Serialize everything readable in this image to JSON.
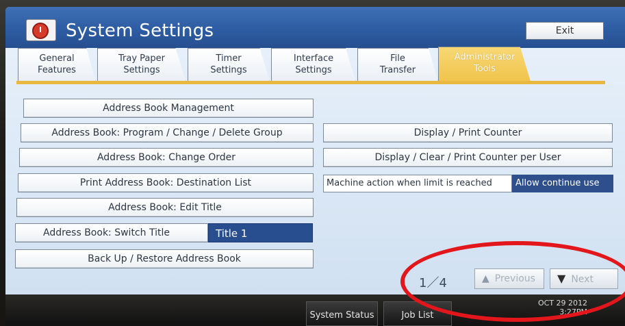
{
  "window": {
    "title": "System Settings",
    "exit_label": "Exit"
  },
  "tabs": [
    {
      "label_line1": "General",
      "label_line2": "Features"
    },
    {
      "label_line1": "Tray Paper",
      "label_line2": "Settings"
    },
    {
      "label_line1": "Timer",
      "label_line2": "Settings"
    },
    {
      "label_line1": "Interface",
      "label_line2": "Settings"
    },
    {
      "label_line1": "File",
      "label_line2": "Transfer"
    },
    {
      "label_line1": "Administrator",
      "label_line2": "Tools",
      "active": true
    }
  ],
  "left_buttons": [
    "Address Book Management",
    "Address Book: Program / Change / Delete Group",
    "Address Book: Change Order",
    "Print Address Book: Destination List",
    "Address Book: Edit Title"
  ],
  "switch_title": {
    "label": "Address Book: Switch Title",
    "value": "Title 1"
  },
  "backup_label": "Back Up / Restore Address Book",
  "right_buttons": [
    "Display / Print Counter",
    "Display / Clear / Print Counter per User"
  ],
  "limit": {
    "label": "Machine action when limit is reached",
    "value": "Allow continue use"
  },
  "pagination": {
    "indicator": "1／4",
    "previous_label": "Previous",
    "next_label": "Next"
  },
  "bottom": {
    "system_status_label": "System Status",
    "job_list_label": "Job List",
    "date": "OCT  29 2012",
    "time": "3:27PM"
  },
  "colors": {
    "accent": "#294e8f",
    "active_tab": "#efc24a",
    "annotation": "#e2161b"
  }
}
